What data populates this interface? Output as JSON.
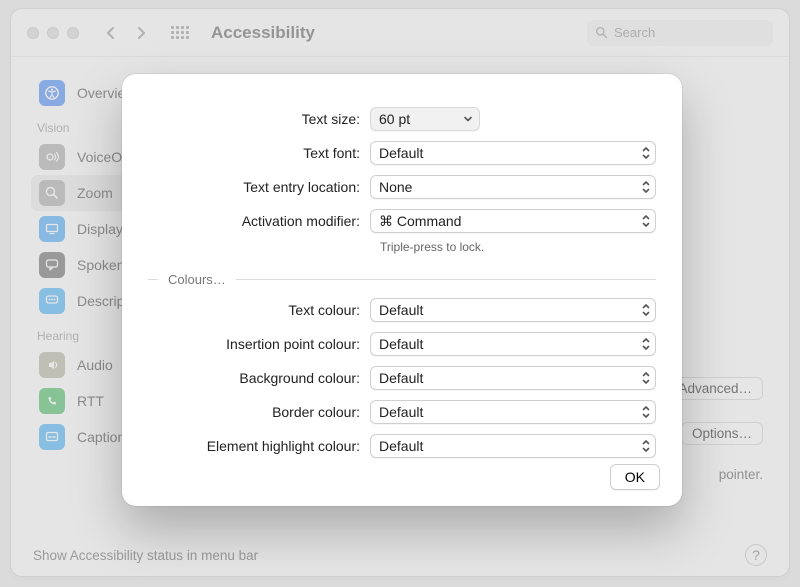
{
  "window": {
    "title": "Accessibility",
    "search_placeholder": "Search"
  },
  "sidebar": {
    "top_item": {
      "label": "Overview"
    },
    "categories": [
      {
        "label": "Vision",
        "items": [
          {
            "label": "VoiceOver"
          },
          {
            "label": "Zoom"
          },
          {
            "label": "Display"
          },
          {
            "label": "Spoken Content"
          },
          {
            "label": "Descriptions"
          }
        ]
      },
      {
        "label": "Hearing",
        "items": [
          {
            "label": "Audio"
          },
          {
            "label": "RTT"
          },
          {
            "label": "Captions"
          }
        ]
      }
    ]
  },
  "right": {
    "advanced": "Advanced…",
    "options": "Options…",
    "pointer_note": "pointer."
  },
  "footer": {
    "status_label": "Show Accessibility status in menu bar",
    "help": "?"
  },
  "sheet": {
    "rows": {
      "text_size": {
        "label": "Text size:",
        "value": "60 pt"
      },
      "text_font": {
        "label": "Text font:",
        "value": "Default"
      },
      "entry_loc": {
        "label": "Text entry location:",
        "value": "None"
      },
      "act_mod": {
        "label": "Activation modifier:",
        "value": "⌘ Command"
      }
    },
    "act_hint": "Triple-press to lock.",
    "section_colours": "Colours…",
    "colours": {
      "text": {
        "label": "Text colour:",
        "value": "Default"
      },
      "insertion": {
        "label": "Insertion point colour:",
        "value": "Default"
      },
      "background": {
        "label": "Background colour:",
        "value": "Default"
      },
      "border": {
        "label": "Border colour:",
        "value": "Default"
      },
      "highlight": {
        "label": "Element highlight colour:",
        "value": "Default"
      }
    },
    "ok": "OK"
  }
}
